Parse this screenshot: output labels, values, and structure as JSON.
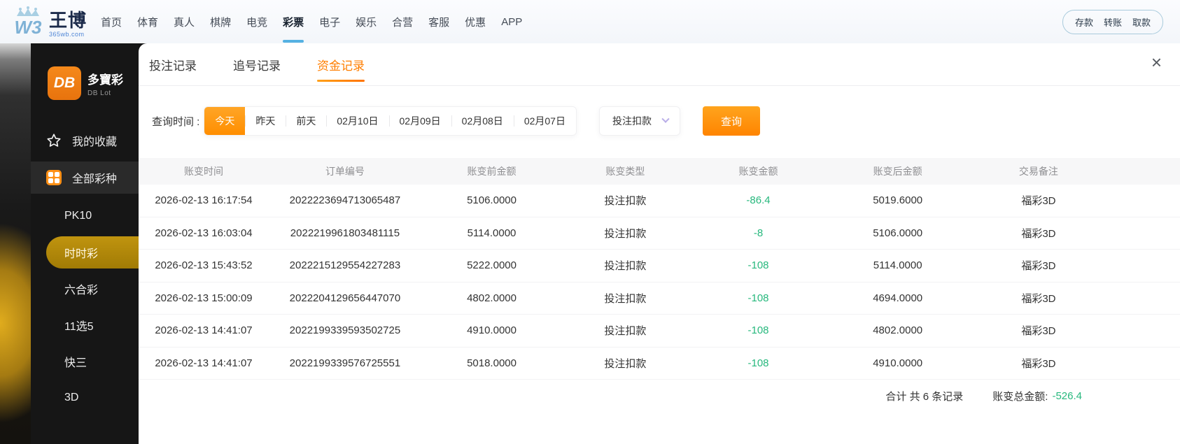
{
  "header": {
    "logo": {
      "mark": "W3",
      "name": "王博",
      "domain": "365wb.com"
    },
    "nav": [
      {
        "label": "首页"
      },
      {
        "label": "体育"
      },
      {
        "label": "真人"
      },
      {
        "label": "棋牌"
      },
      {
        "label": "电竞"
      },
      {
        "label": "彩票",
        "active": true
      },
      {
        "label": "电子"
      },
      {
        "label": "娱乐"
      },
      {
        "label": "合营"
      },
      {
        "label": "客服"
      },
      {
        "label": "优惠"
      },
      {
        "label": "APP"
      }
    ],
    "wallet_actions": [
      "存款",
      "转账",
      "取款"
    ]
  },
  "sidebar": {
    "logo": {
      "mark": "DB",
      "name": "多寶彩",
      "subname": "DB Lot"
    },
    "favorites": {
      "label": "我的收藏"
    },
    "all_lotteries": {
      "label": "全部彩种"
    },
    "lotteries": [
      {
        "label": "PK10"
      },
      {
        "label": "时时彩",
        "active": true
      },
      {
        "label": "六合彩"
      },
      {
        "label": "11选5"
      },
      {
        "label": "快三"
      },
      {
        "label": "3D"
      }
    ]
  },
  "panel": {
    "tabs": [
      {
        "label": "投注记录"
      },
      {
        "label": "追号记录"
      },
      {
        "label": "资金记录",
        "active": true
      }
    ],
    "close_glyph": "×",
    "filters": {
      "label": "查询时间 :",
      "dates": [
        {
          "label": "今天",
          "active": true
        },
        {
          "label": "昨天"
        },
        {
          "label": "前天"
        },
        {
          "label": "02月10日"
        },
        {
          "label": "02月09日"
        },
        {
          "label": "02月08日"
        },
        {
          "label": "02月07日"
        }
      ],
      "type_filter": {
        "value": "投注扣款"
      },
      "search_label": "查询"
    },
    "table": {
      "columns": [
        "账变时间",
        "订单编号",
        "账变前金额",
        "账变类型",
        "账变金额",
        "账变后金额",
        "交易备注"
      ],
      "rows": [
        {
          "time": "2026-02-13 16:17:54",
          "order": "2022223694713065487",
          "before": "5106.0000",
          "type": "投注扣款",
          "change": "-86.4",
          "after": "5019.6000",
          "remark": "福彩3D"
        },
        {
          "time": "2026-02-13 16:03:04",
          "order": "2022219961803481115",
          "before": "5114.0000",
          "type": "投注扣款",
          "change": "-8",
          "after": "5106.0000",
          "remark": "福彩3D"
        },
        {
          "time": "2026-02-13 15:43:52",
          "order": "2022215129554227283",
          "before": "5222.0000",
          "type": "投注扣款",
          "change": "-108",
          "after": "5114.0000",
          "remark": "福彩3D"
        },
        {
          "time": "2026-02-13 15:00:09",
          "order": "2022204129656447070",
          "before": "4802.0000",
          "type": "投注扣款",
          "change": "-108",
          "after": "4694.0000",
          "remark": "福彩3D"
        },
        {
          "time": "2026-02-13 14:41:07",
          "order": "2022199339593502725",
          "before": "4910.0000",
          "type": "投注扣款",
          "change": "-108",
          "after": "4802.0000",
          "remark": "福彩3D"
        },
        {
          "time": "2026-02-13 14:41:07",
          "order": "2022199339576725551",
          "before": "5018.0000",
          "type": "投注扣款",
          "change": "-108",
          "after": "4910.0000",
          "remark": "福彩3D"
        }
      ]
    },
    "summary": {
      "count_text": "合计 共 6 条记录",
      "total_label": "账变总金额:",
      "total_value": "-526.4"
    }
  },
  "colors": {
    "accent_orange": "#ff8400",
    "tab_active_orange": "#ff7e00",
    "negative_green": "#27b87d",
    "sidebar_active_gold": "#b08708",
    "nav_underline_blue": "#55b1e2",
    "sidebar_bg": "#161616"
  }
}
